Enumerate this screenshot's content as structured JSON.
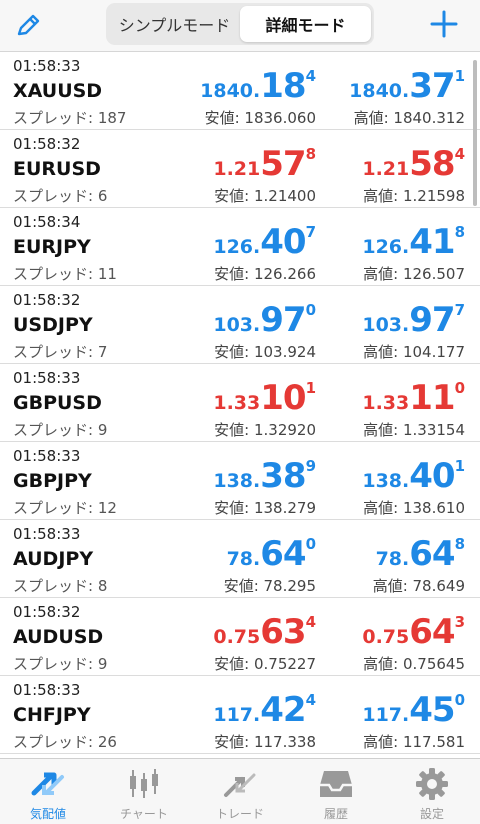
{
  "header": {
    "segments": [
      "シンプルモード",
      "詳細モード"
    ],
    "active_segment": "詳細モード"
  },
  "quotes": [
    {
      "time": "01:58:33",
      "symbol": "XAUUSD",
      "spread_label": "スプレッド: 187",
      "bid": {
        "small": "1840.",
        "big": "18",
        "sup": "4"
      },
      "ask": {
        "small": "1840.",
        "big": "37",
        "sup": "1"
      },
      "color": "blue",
      "low_label": "安値: 1836.060",
      "high_label": "高値: 1840.312"
    },
    {
      "time": "01:58:32",
      "symbol": "EURUSD",
      "spread_label": "スプレッド: 6",
      "bid": {
        "small": "1.21",
        "big": "57",
        "sup": "8"
      },
      "ask": {
        "small": "1.21",
        "big": "58",
        "sup": "4"
      },
      "color": "red",
      "low_label": "安値: 1.21400",
      "high_label": "高値: 1.21598"
    },
    {
      "time": "01:58:34",
      "symbol": "EURJPY",
      "spread_label": "スプレッド: 11",
      "bid": {
        "small": "126.",
        "big": "40",
        "sup": "7"
      },
      "ask": {
        "small": "126.",
        "big": "41",
        "sup": "8"
      },
      "color": "blue",
      "low_label": "安値: 126.266",
      "high_label": "高値: 126.507"
    },
    {
      "time": "01:58:32",
      "symbol": "USDJPY",
      "spread_label": "スプレッド: 7",
      "bid": {
        "small": "103.",
        "big": "97",
        "sup": "0"
      },
      "ask": {
        "small": "103.",
        "big": "97",
        "sup": "7"
      },
      "color": "blue",
      "low_label": "安値: 103.924",
      "high_label": "高値: 104.177"
    },
    {
      "time": "01:58:33",
      "symbol": "GBPUSD",
      "spread_label": "スプレッド: 9",
      "bid": {
        "small": "1.33",
        "big": "10",
        "sup": "1"
      },
      "ask": {
        "small": "1.33",
        "big": "11",
        "sup": "0"
      },
      "color": "red",
      "low_label": "安値: 1.32920",
      "high_label": "高値: 1.33154"
    },
    {
      "time": "01:58:33",
      "symbol": "GBPJPY",
      "spread_label": "スプレッド: 12",
      "bid": {
        "small": "138.",
        "big": "38",
        "sup": "9"
      },
      "ask": {
        "small": "138.",
        "big": "40",
        "sup": "1"
      },
      "color": "blue",
      "low_label": "安値: 138.279",
      "high_label": "高値: 138.610"
    },
    {
      "time": "01:58:33",
      "symbol": "AUDJPY",
      "spread_label": "スプレッド: 8",
      "bid": {
        "small": "78.",
        "big": "64",
        "sup": "0"
      },
      "ask": {
        "small": "78.",
        "big": "64",
        "sup": "8"
      },
      "color": "blue",
      "low_label": "安値: 78.295",
      "high_label": "高値: 78.649"
    },
    {
      "time": "01:58:32",
      "symbol": "AUDUSD",
      "spread_label": "スプレッド: 9",
      "bid": {
        "small": "0.75",
        "big": "63",
        "sup": "4"
      },
      "ask": {
        "small": "0.75",
        "big": "64",
        "sup": "3"
      },
      "color": "red",
      "low_label": "安値: 0.75227",
      "high_label": "高値: 0.75645"
    },
    {
      "time": "01:58:33",
      "symbol": "CHFJPY",
      "spread_label": "スプレッド: 26",
      "bid": {
        "small": "117.",
        "big": "42",
        "sup": "4"
      },
      "ask": {
        "small": "117.",
        "big": "45",
        "sup": "0"
      },
      "color": "blue",
      "low_label": "安値: 117.338",
      "high_label": "高値: 117.581"
    }
  ],
  "tabs": [
    {
      "label": "気配値",
      "icon": "quotes-icon",
      "active": true
    },
    {
      "label": "チャート",
      "icon": "candlestick-chart-icon",
      "active": false
    },
    {
      "label": "トレード",
      "icon": "trade-icon",
      "active": false
    },
    {
      "label": "履歴",
      "icon": "history-inbox-icon",
      "active": false
    },
    {
      "label": "設定",
      "icon": "gear-icon",
      "active": false
    }
  ],
  "colors": {
    "blue": "#1e88e5",
    "red": "#e53935",
    "accent": "#1e88e5",
    "inactive": "#999999"
  }
}
